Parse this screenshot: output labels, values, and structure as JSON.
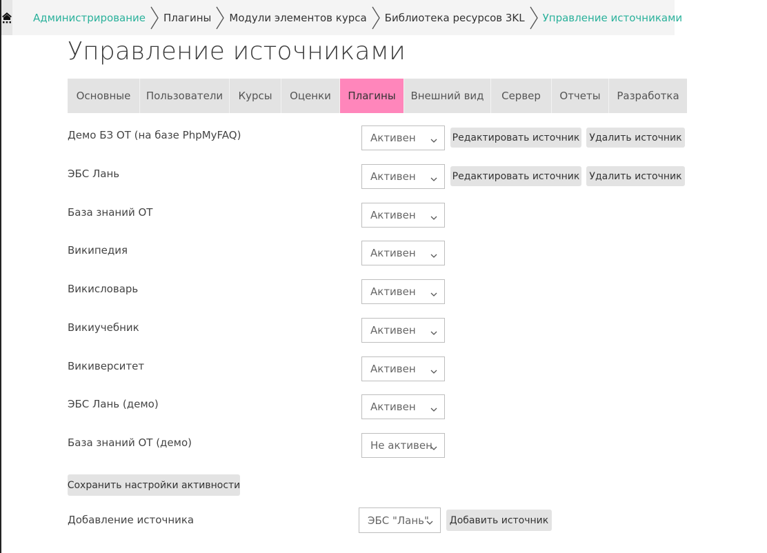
{
  "breadcrumb": {
    "home_icon": "home-icon",
    "items": [
      {
        "label": "Администрирование",
        "type": "link"
      },
      {
        "label": "Плагины",
        "type": "plain"
      },
      {
        "label": "Модули элементов курса",
        "type": "plain"
      },
      {
        "label": "Библиотека ресурсов 3KL",
        "type": "plain"
      },
      {
        "label": "Управление источниками",
        "type": "current"
      }
    ]
  },
  "page_title": "Управление источниками",
  "tabs": [
    {
      "label": "Основные"
    },
    {
      "label": "Пользователи"
    },
    {
      "label": "Курсы"
    },
    {
      "label": "Оценки"
    },
    {
      "label": "Плагины",
      "active": true
    },
    {
      "label": "Внешний вид"
    },
    {
      "label": "Сервер"
    },
    {
      "label": "Отчеты"
    },
    {
      "label": "Разработка"
    }
  ],
  "sources": [
    {
      "name": "Демо БЗ ОТ (на базе PhpMyFAQ)",
      "status": "Активен",
      "edit_label": "Редактировать источник",
      "delete_label": "Удалить источник"
    },
    {
      "name": "ЭБС Лань",
      "status": "Активен",
      "edit_label": "Редактировать источник",
      "delete_label": "Удалить источник"
    },
    {
      "name": "База знаний ОТ",
      "status": "Активен"
    },
    {
      "name": "Википедия",
      "status": "Активен"
    },
    {
      "name": "Викисловарь",
      "status": "Активен"
    },
    {
      "name": "Викиучебник",
      "status": "Активен"
    },
    {
      "name": "Викиверситет",
      "status": "Активен"
    },
    {
      "name": "ЭБС Лань (демо)",
      "status": "Активен"
    },
    {
      "name": "База знаний ОТ (демо)",
      "status": "Не активен"
    }
  ],
  "save_button": "Сохранить настройки активности",
  "add_source": {
    "label": "Добавление источника",
    "selected": "ЭБС \"Лань\"",
    "button": "Добавить источник"
  },
  "colors": {
    "accent_link": "#2ab19b",
    "active_tab": "#ff86bb",
    "tab_bg": "#e3e3e3"
  }
}
